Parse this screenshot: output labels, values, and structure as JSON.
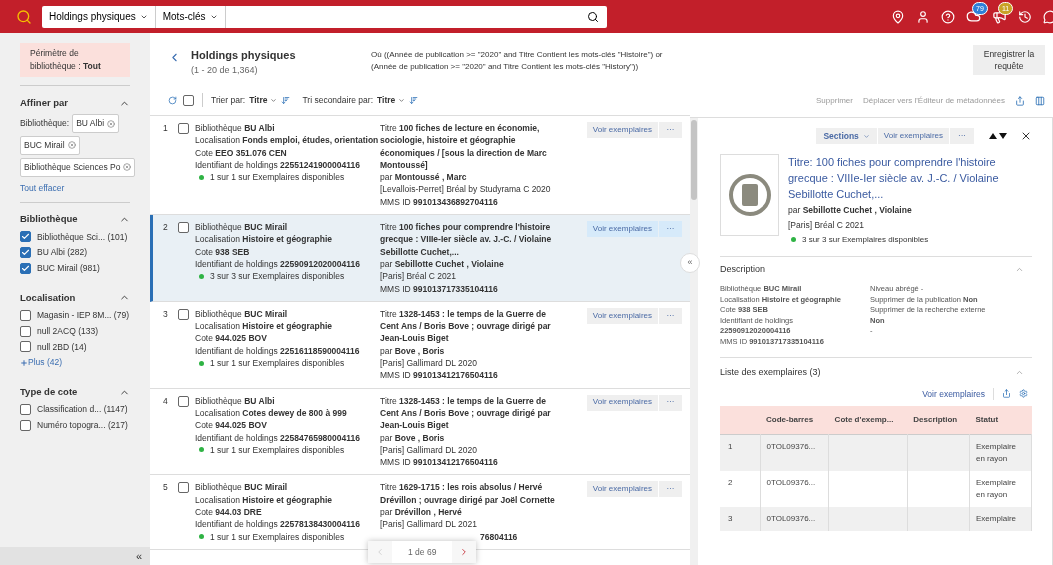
{
  "topbar": {
    "scope": "Holdings physiques",
    "field": "Mots-clés",
    "badges": [
      {
        "kind": "cloud",
        "count": "79",
        "color": "#2f7fd8"
      },
      {
        "kind": "megaphone",
        "count": "11",
        "color": "#c9a227"
      }
    ]
  },
  "sidebar": {
    "scope_label": "Périmètre de bibliothèque : **Tout**",
    "refine_title": "Affiner par",
    "chips_label": "Bibliothèque:",
    "chips": [
      "BU Albi",
      "BUC Mirail",
      "Bibliothèque Sciences Po"
    ],
    "clear": "Tout effacer",
    "facets": [
      {
        "title": "Bibliothèque",
        "expanded": true,
        "items": [
          {
            "label": "Bibliothèque Sci...",
            "count": "(101)",
            "checked": true
          },
          {
            "label": "BU Albi",
            "count": "(282)",
            "checked": true
          },
          {
            "label": "BUC Mirail",
            "count": "(981)",
            "checked": true
          }
        ]
      },
      {
        "title": "Localisation",
        "expanded": true,
        "items": [
          {
            "label": "Magasin - IEP 8M...",
            "count": "(79)",
            "checked": false
          },
          {
            "label": "null 2ACQ",
            "count": "(133)",
            "checked": false
          },
          {
            "label": "null 2BD",
            "count": "(14)",
            "checked": false
          }
        ],
        "more": "Plus (42)"
      },
      {
        "title": "Type de cote",
        "expanded": true,
        "items": [
          {
            "label": "Classification d...",
            "count": "(1147)",
            "checked": false
          },
          {
            "label": "Numéro topogra...",
            "count": "(217)",
            "checked": false
          }
        ]
      }
    ],
    "collapse": "«"
  },
  "results": {
    "title": "Holdings physiques",
    "range": "(1 - 20 de 1,364)",
    "query": "Où ((Année de publication >= \"2020\" and Titre Contient les mots-clés \"Histoire\") or (Année de publication >= \"2020\" and Titre Contient les mots-clés \"History\"))",
    "save": "Enregistrer la requête",
    "select_all": false,
    "sort_label": "Trier par:",
    "sort_value": "Titre",
    "sort2_label": "Tri secondaire par:",
    "sort2_value": "Titre",
    "delete": "Supprimer",
    "move": "Déplacer vers l'Éditeur de métadonnées",
    "rows": [
      {
        "num": "1",
        "selected": false,
        "checked": false,
        "left": [
          {
            "label": "Bibliothèque",
            "value": "BU Albi"
          },
          {
            "label": "Localisation",
            "value": "Fonds emploi, études, orientation"
          },
          {
            "label": "Cote",
            "value": "EEO 351.076 CEN"
          },
          {
            "label": "Identifiant de holdings",
            "value": "22551241900004116"
          }
        ],
        "status": "1 sur 1 sur Exemplaires disponibles",
        "right": [
          {
            "label": "Titre",
            "value": "100 fiches de lecture en économie, sociologie, histoire et géographie économiques / [sous la direction de Marc Montoussé]"
          },
          {
            "label": "par",
            "value": "Montoussé , Marc"
          },
          {
            "value": "[Levallois-Perret] Bréal by Studyrama C 2020"
          },
          {
            "label": "MMS ID",
            "value": "991013436892704116"
          }
        ],
        "button": "Voir exemplaires",
        "more": "···"
      },
      {
        "num": "2",
        "selected": true,
        "checked": false,
        "left": [
          {
            "label": "Bibliothèque",
            "value": "BUC Mirail"
          },
          {
            "label": "Localisation",
            "value": "Histoire et géographie"
          },
          {
            "label": "Cote",
            "value": "938 SEB"
          },
          {
            "label": "Identifiant de holdings",
            "value": "22590912020004116"
          }
        ],
        "status": "3 sur 3 sur Exemplaires disponibles",
        "right": [
          {
            "label": "Titre",
            "value": "100 fiches pour comprendre l'histoire grecque : VIIIe-Ier siècle av. J.-C. / Violaine Sebillotte Cuchet,..."
          },
          {
            "label": "par",
            "value": "Sebillotte Cuchet , Violaine"
          },
          {
            "value": "[Paris] Bréal C 2021"
          },
          {
            "label": "MMS ID",
            "value": "991013717335104116"
          }
        ],
        "button": "Voir exemplaires",
        "more": "···"
      },
      {
        "num": "3",
        "selected": false,
        "checked": false,
        "left": [
          {
            "label": "Bibliothèque",
            "value": "BUC Mirail"
          },
          {
            "label": "Localisation",
            "value": "Histoire et géographie"
          },
          {
            "label": "Cote",
            "value": "944.025 BOV"
          },
          {
            "label": "Identifiant de holdings",
            "value": "22516118590004116"
          }
        ],
        "status": "1 sur 1 sur Exemplaires disponibles",
        "right": [
          {
            "label": "Titre",
            "value": "1328-1453 : le temps de la Guerre de Cent Ans / Boris Bove ; ouvrage dirigé par Jean-Louis Biget"
          },
          {
            "label": "par",
            "value": "Bove , Boris"
          },
          {
            "value": "[Paris] Gallimard DL 2020"
          },
          {
            "label": "MMS ID",
            "value": "991013412176504116"
          }
        ],
        "button": "Voir exemplaires",
        "more": "···"
      },
      {
        "num": "4",
        "selected": false,
        "checked": false,
        "left": [
          {
            "label": "Bibliothèque",
            "value": "BU Albi"
          },
          {
            "label": "Localisation",
            "value": "Cotes dewey de 800 à 999"
          },
          {
            "label": "Cote",
            "value": "944.025 BOV"
          },
          {
            "label": "Identifiant de holdings",
            "value": "22584765980004116"
          }
        ],
        "status": "1 sur 1 sur Exemplaires disponibles",
        "right": [
          {
            "label": "Titre",
            "value": "1328-1453 : le temps de la Guerre de Cent Ans / Boris Bove ; ouvrage dirigé par Jean-Louis Biget"
          },
          {
            "label": "par",
            "value": "Bove , Boris"
          },
          {
            "value": "[Paris] Gallimard DL 2020"
          },
          {
            "label": "MMS ID",
            "value": "991013412176504116"
          }
        ],
        "button": "Voir exemplaires",
        "more": "···"
      },
      {
        "num": "5",
        "selected": false,
        "checked": false,
        "left": [
          {
            "label": "Bibliothèque",
            "value": "BUC Mirail"
          },
          {
            "label": "Localisation",
            "value": "Histoire et géographie"
          },
          {
            "label": "Cote",
            "value": "944.03 DRE"
          },
          {
            "label": "Identifiant de holdings",
            "value": "22578138430004116"
          }
        ],
        "status": "1 sur 1 sur Exemplaires disponibles",
        "right": [
          {
            "label": "Titre",
            "value": "1629-1715 : les rois absolus / Hervé Drévillon ; ouvrage dirigé par Joël Cornette"
          },
          {
            "label": "par",
            "value": "Drévillon , Hervé"
          },
          {
            "value": "[Paris] Gallimard DL 2021"
          },
          {
            "value": "76804116"
          }
        ],
        "button": "Voir exemplaires",
        "more": "···"
      }
    ],
    "pager": {
      "text": "1 de 69"
    },
    "panel_toggle": "«"
  },
  "detail": {
    "sections": "Sections",
    "button": "Voir exemplaires",
    "more": "···",
    "title": "Titre: 100 fiches pour comprendre l'histoire grecque : VIIIe-Ier siècle av. J.-C. / Violaine Sebillotte Cuchet,...",
    "author_label": "par",
    "author": "Sebillotte Cuchet , Violaine",
    "publisher": "[Paris] Bréal C 2021",
    "status": "3 sur 3 sur Exemplaires disponibles",
    "description": {
      "title": "Description",
      "expanded": true,
      "left": [
        "Bibliothèque **BUC Mirail**",
        "Localisation **Histoire et géographie**",
        "Cote **938 SEB**",
        "Identifiant de holdings",
        "**22590912020004116**",
        "MMS ID **991013717335104116**"
      ],
      "right": [
        "Niveau abrégé -",
        "Supprimer de la publication **Non**",
        "Supprimer de la recherche externe",
        "**Non**",
        "-"
      ]
    },
    "items": {
      "title": "Liste des exemplaires (3)",
      "expanded": true,
      "link": "Voir exemplaires",
      "columns": [
        "Code-barres",
        "Cote d'exemp...",
        "Description",
        "Statut"
      ],
      "rows": [
        {
          "num": "1",
          "cells": [
            "0TOL09376...",
            "",
            "",
            "Exemplaire en rayon"
          ]
        },
        {
          "num": "2",
          "cells": [
            "0TOL09376...",
            "",
            "",
            "Exemplaire en rayon"
          ]
        },
        {
          "num": "3",
          "cells": [
            "0TOL09376...",
            "",
            "",
            "Exemplaire"
          ]
        }
      ]
    }
  }
}
